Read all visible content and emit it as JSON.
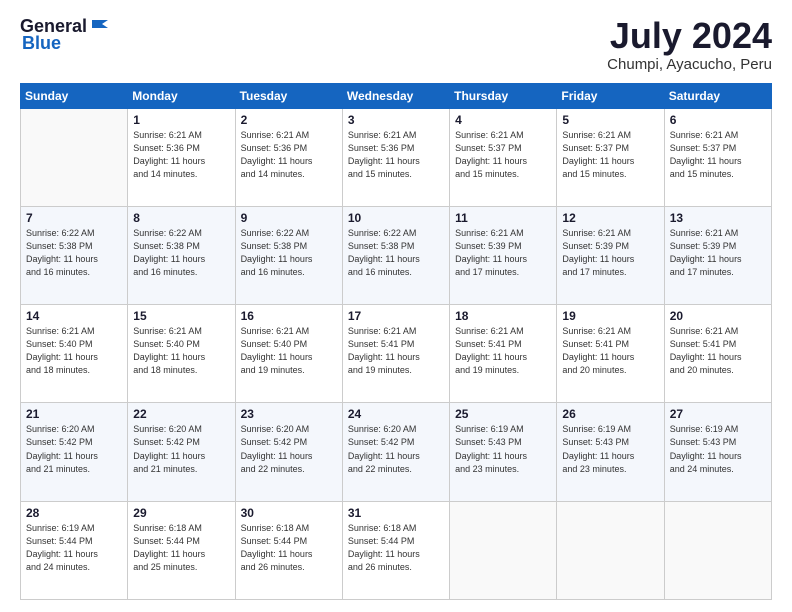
{
  "header": {
    "logo_general": "General",
    "logo_blue": "Blue",
    "month_title": "July 2024",
    "location": "Chumpi, Ayacucho, Peru"
  },
  "weekdays": [
    "Sunday",
    "Monday",
    "Tuesday",
    "Wednesday",
    "Thursday",
    "Friday",
    "Saturday"
  ],
  "weeks": [
    [
      {
        "day": "",
        "info": ""
      },
      {
        "day": "1",
        "info": "Sunrise: 6:21 AM\nSunset: 5:36 PM\nDaylight: 11 hours\nand 14 minutes."
      },
      {
        "day": "2",
        "info": "Sunrise: 6:21 AM\nSunset: 5:36 PM\nDaylight: 11 hours\nand 14 minutes."
      },
      {
        "day": "3",
        "info": "Sunrise: 6:21 AM\nSunset: 5:36 PM\nDaylight: 11 hours\nand 15 minutes."
      },
      {
        "day": "4",
        "info": "Sunrise: 6:21 AM\nSunset: 5:37 PM\nDaylight: 11 hours\nand 15 minutes."
      },
      {
        "day": "5",
        "info": "Sunrise: 6:21 AM\nSunset: 5:37 PM\nDaylight: 11 hours\nand 15 minutes."
      },
      {
        "day": "6",
        "info": "Sunrise: 6:21 AM\nSunset: 5:37 PM\nDaylight: 11 hours\nand 15 minutes."
      }
    ],
    [
      {
        "day": "7",
        "info": "Sunrise: 6:22 AM\nSunset: 5:38 PM\nDaylight: 11 hours\nand 16 minutes."
      },
      {
        "day": "8",
        "info": "Sunrise: 6:22 AM\nSunset: 5:38 PM\nDaylight: 11 hours\nand 16 minutes."
      },
      {
        "day": "9",
        "info": "Sunrise: 6:22 AM\nSunset: 5:38 PM\nDaylight: 11 hours\nand 16 minutes."
      },
      {
        "day": "10",
        "info": "Sunrise: 6:22 AM\nSunset: 5:38 PM\nDaylight: 11 hours\nand 16 minutes."
      },
      {
        "day": "11",
        "info": "Sunrise: 6:21 AM\nSunset: 5:39 PM\nDaylight: 11 hours\nand 17 minutes."
      },
      {
        "day": "12",
        "info": "Sunrise: 6:21 AM\nSunset: 5:39 PM\nDaylight: 11 hours\nand 17 minutes."
      },
      {
        "day": "13",
        "info": "Sunrise: 6:21 AM\nSunset: 5:39 PM\nDaylight: 11 hours\nand 17 minutes."
      }
    ],
    [
      {
        "day": "14",
        "info": "Sunrise: 6:21 AM\nSunset: 5:40 PM\nDaylight: 11 hours\nand 18 minutes."
      },
      {
        "day": "15",
        "info": "Sunrise: 6:21 AM\nSunset: 5:40 PM\nDaylight: 11 hours\nand 18 minutes."
      },
      {
        "day": "16",
        "info": "Sunrise: 6:21 AM\nSunset: 5:40 PM\nDaylight: 11 hours\nand 19 minutes."
      },
      {
        "day": "17",
        "info": "Sunrise: 6:21 AM\nSunset: 5:41 PM\nDaylight: 11 hours\nand 19 minutes."
      },
      {
        "day": "18",
        "info": "Sunrise: 6:21 AM\nSunset: 5:41 PM\nDaylight: 11 hours\nand 19 minutes."
      },
      {
        "day": "19",
        "info": "Sunrise: 6:21 AM\nSunset: 5:41 PM\nDaylight: 11 hours\nand 20 minutes."
      },
      {
        "day": "20",
        "info": "Sunrise: 6:21 AM\nSunset: 5:41 PM\nDaylight: 11 hours\nand 20 minutes."
      }
    ],
    [
      {
        "day": "21",
        "info": "Sunrise: 6:20 AM\nSunset: 5:42 PM\nDaylight: 11 hours\nand 21 minutes."
      },
      {
        "day": "22",
        "info": "Sunrise: 6:20 AM\nSunset: 5:42 PM\nDaylight: 11 hours\nand 21 minutes."
      },
      {
        "day": "23",
        "info": "Sunrise: 6:20 AM\nSunset: 5:42 PM\nDaylight: 11 hours\nand 22 minutes."
      },
      {
        "day": "24",
        "info": "Sunrise: 6:20 AM\nSunset: 5:42 PM\nDaylight: 11 hours\nand 22 minutes."
      },
      {
        "day": "25",
        "info": "Sunrise: 6:19 AM\nSunset: 5:43 PM\nDaylight: 11 hours\nand 23 minutes."
      },
      {
        "day": "26",
        "info": "Sunrise: 6:19 AM\nSunset: 5:43 PM\nDaylight: 11 hours\nand 23 minutes."
      },
      {
        "day": "27",
        "info": "Sunrise: 6:19 AM\nSunset: 5:43 PM\nDaylight: 11 hours\nand 24 minutes."
      }
    ],
    [
      {
        "day": "28",
        "info": "Sunrise: 6:19 AM\nSunset: 5:44 PM\nDaylight: 11 hours\nand 24 minutes."
      },
      {
        "day": "29",
        "info": "Sunrise: 6:18 AM\nSunset: 5:44 PM\nDaylight: 11 hours\nand 25 minutes."
      },
      {
        "day": "30",
        "info": "Sunrise: 6:18 AM\nSunset: 5:44 PM\nDaylight: 11 hours\nand 26 minutes."
      },
      {
        "day": "31",
        "info": "Sunrise: 6:18 AM\nSunset: 5:44 PM\nDaylight: 11 hours\nand 26 minutes."
      },
      {
        "day": "",
        "info": ""
      },
      {
        "day": "",
        "info": ""
      },
      {
        "day": "",
        "info": ""
      }
    ]
  ]
}
